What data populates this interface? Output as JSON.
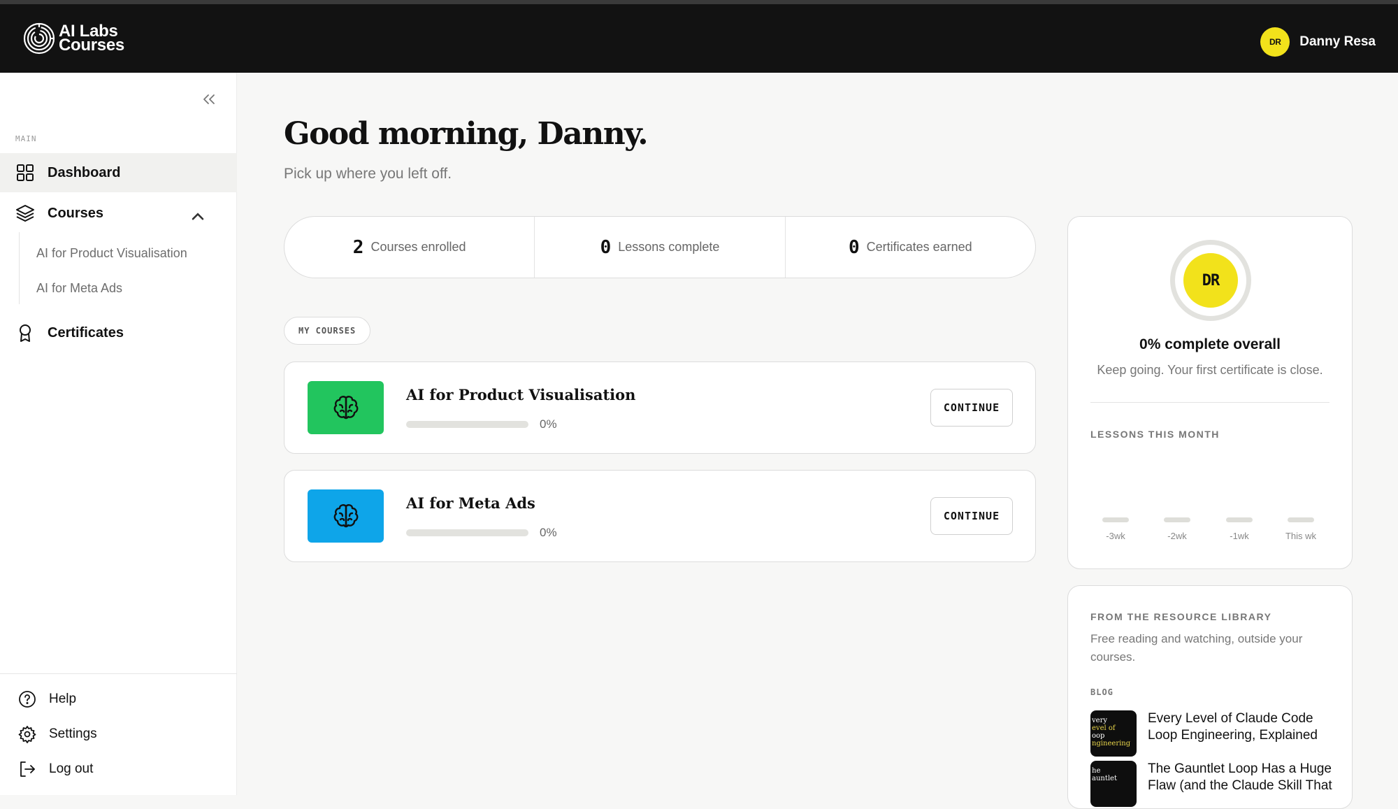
{
  "app": {
    "logo_line1": "AI Labs",
    "logo_line2": "Courses",
    "accent": "#f2e21b"
  },
  "user": {
    "initials": "DR",
    "name": "Danny Resa"
  },
  "sidebar": {
    "section_label": "MAIN",
    "dashboard": "Dashboard",
    "courses": "Courses",
    "sub_items": [
      "AI for Product Visualisation",
      "AI for Meta Ads"
    ],
    "certificates": "Certificates",
    "help": "Help",
    "settings": "Settings",
    "logout": "Log out"
  },
  "main": {
    "greeting": "Good morning, Danny.",
    "subtitle": "Pick up where you left off.",
    "stats": [
      {
        "value": "2",
        "label": "Courses enrolled"
      },
      {
        "value": "0",
        "label": "Lessons complete"
      },
      {
        "value": "0",
        "label": "Certificates earned"
      }
    ],
    "my_courses_label": "MY COURSES",
    "courses": [
      {
        "title": "AI for Product Visualisation",
        "progress_label": "0%",
        "progress": 0,
        "color": "#22c55e",
        "action": "CONTINUE",
        "icon": "brain-icon"
      },
      {
        "title": "AI for Meta Ads",
        "progress_label": "0%",
        "progress": 0,
        "color": "#0ea5e9",
        "action": "CONTINUE",
        "icon": "brain-icon"
      }
    ]
  },
  "progress_card": {
    "initials": "DR",
    "overall": "0% complete overall",
    "overall_sub": "Keep going. Your first certificate is close.",
    "lessons_label": "LESSONS THIS MONTH",
    "weeks": [
      "-3wk",
      "-2wk",
      "-1wk",
      "This wk"
    ]
  },
  "library": {
    "title": "FROM THE RESOURCE LIBRARY",
    "subtitle": "Free reading and watching, outside your courses.",
    "tag": "BLOG",
    "posts": [
      {
        "title": "Every Level of Claude Code Loop Engineering, Explained",
        "thumb": [
          "very",
          "evel of",
          "oop",
          "ngineering"
        ]
      },
      {
        "title": "The Gauntlet Loop Has a Huge Flaw (and the Claude Skill That",
        "thumb": [
          "he",
          "auntlet"
        ]
      }
    ]
  }
}
